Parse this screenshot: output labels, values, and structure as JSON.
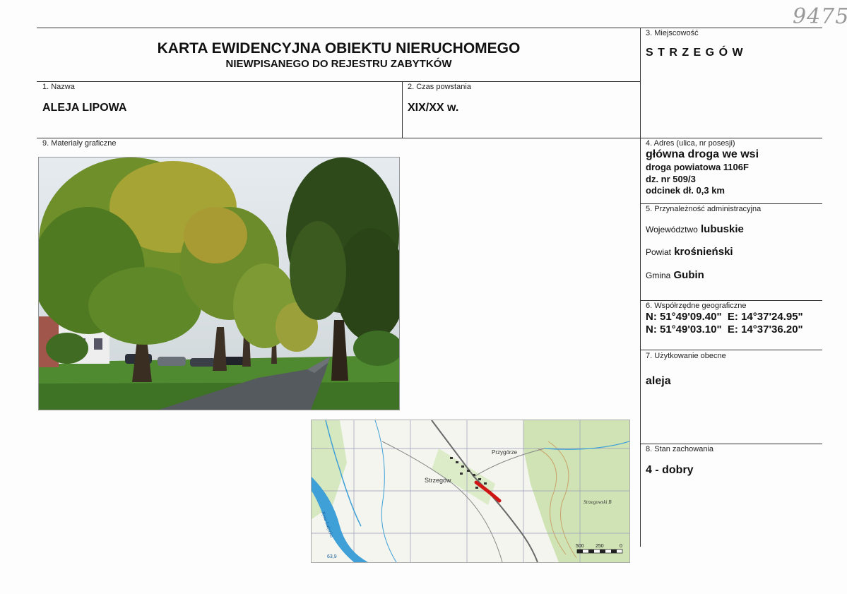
{
  "handwritten_number": "9475",
  "header": {
    "title": "KARTA EWIDENCYJNA OBIEKTU NIERUCHOMEGO",
    "subtitle": "NIEWPISANEGO DO REJESTRU ZABYTKÓW"
  },
  "locality": {
    "label": "3. Miejscowość",
    "value": "S T R Z E G Ó W"
  },
  "name": {
    "label": "1. Nazwa",
    "value": "ALEJA LIPOWA"
  },
  "period": {
    "label": "2. Czas powstania",
    "value": "XIX/XX w."
  },
  "graphics": {
    "label": "9. Materiały graficzne"
  },
  "address": {
    "label": "4. Adres (ulica, nr posesji)",
    "line1": "główna droga we wsi",
    "line2": "droga powiatowa 1106F",
    "line3": "dz. nr 509/3",
    "line4": "odcinek dł. 0,3 km"
  },
  "admin": {
    "label": "5. Przynależność administracyjna",
    "voivodeship_label": "Województwo",
    "voivodeship": "lubuskie",
    "county_label": "Powiat",
    "county": "krośnieński",
    "commune_label": "Gmina",
    "commune": "Gubin"
  },
  "coords": {
    "label": "6. Współrzędne geograficzne",
    "line1": "N: 51°49'09.40\"  E: 14°37'24.95\"",
    "line2": "N: 51°49'03.10\"  E: 14°37'36.20\""
  },
  "usage": {
    "label": "7. Użytkowanie obecne",
    "value": "aleja"
  },
  "condition": {
    "label": "8. Stan zachowania",
    "value": "4 - dobry"
  },
  "map_labels": {
    "village": "Strzegów",
    "przygorze": "Przygórze",
    "river": "Nysa Łużycka",
    "forest": "Strzegowski B",
    "spot_bottom": "63,9",
    "scale_500": "500",
    "scale_250": "250",
    "scale_0": "0"
  },
  "colors": {
    "route": "#d01515",
    "forest": "#cfe3b5",
    "water": "#3fa0d8",
    "grid": "#9a9ab8"
  }
}
